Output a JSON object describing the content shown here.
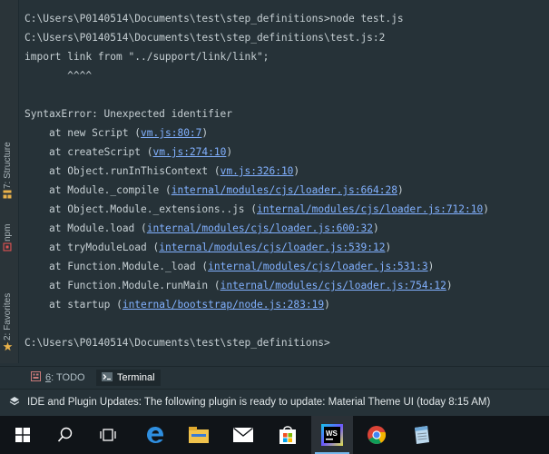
{
  "sidebar": {
    "structure_label": "7: Structure",
    "npm_label": "npm",
    "favorites_label": "2: Favorites"
  },
  "terminal": {
    "lines": [
      "C:\\Users\\P0140514\\Documents\\test\\step_definitions>node test.js",
      "C:\\Users\\P0140514\\Documents\\test\\step_definitions\\test.js:2",
      "import link from \"../support/link/link\";",
      "       ^^^^",
      "SyntaxError: Unexpected identifier"
    ],
    "stack": [
      {
        "prefix": "at new Script (",
        "link": "vm.js:80:7"
      },
      {
        "prefix": "at createScript (",
        "link": "vm.js:274:10"
      },
      {
        "prefix": "at Object.runInThisContext (",
        "link": "vm.js:326:10"
      },
      {
        "prefix": "at Module._compile (",
        "link": "internal/modules/cjs/loader.js:664:28"
      },
      {
        "prefix": "at Object.Module._extensions..js (",
        "link": "internal/modules/cjs/loader.js:712:10"
      },
      {
        "prefix": "at Module.load (",
        "link": "internal/modules/cjs/loader.js:600:32"
      },
      {
        "prefix": "at tryModuleLoad (",
        "link": "internal/modules/cjs/loader.js:539:12"
      },
      {
        "prefix": "at Function.Module._load (",
        "link": "internal/modules/cjs/loader.js:531:3"
      },
      {
        "prefix": "at Function.Module.runMain (",
        "link": "internal/modules/cjs/loader.js:754:12"
      },
      {
        "prefix": "at startup (",
        "link": "internal/bootstrap/node.js:283:19"
      }
    ],
    "suffix": ")",
    "prompt": "C:\\Users\\P0140514\\Documents\\test\\step_definitions>"
  },
  "toolwindows": {
    "todo_number": "6",
    "todo_label": ": TODO",
    "terminal_label": "Terminal"
  },
  "statusbar": {
    "message": "IDE and Plugin Updates: The following plugin is ready to update: Material Theme UI (today 8:15 AM)"
  },
  "taskbar": {
    "icons": [
      "windows-start-icon",
      "search-icon",
      "task-view-icon",
      "edge-icon",
      "file-explorer-icon",
      "mail-icon",
      "store-icon",
      "webstorm-icon",
      "chrome-icon",
      "notepad-icon"
    ]
  }
}
